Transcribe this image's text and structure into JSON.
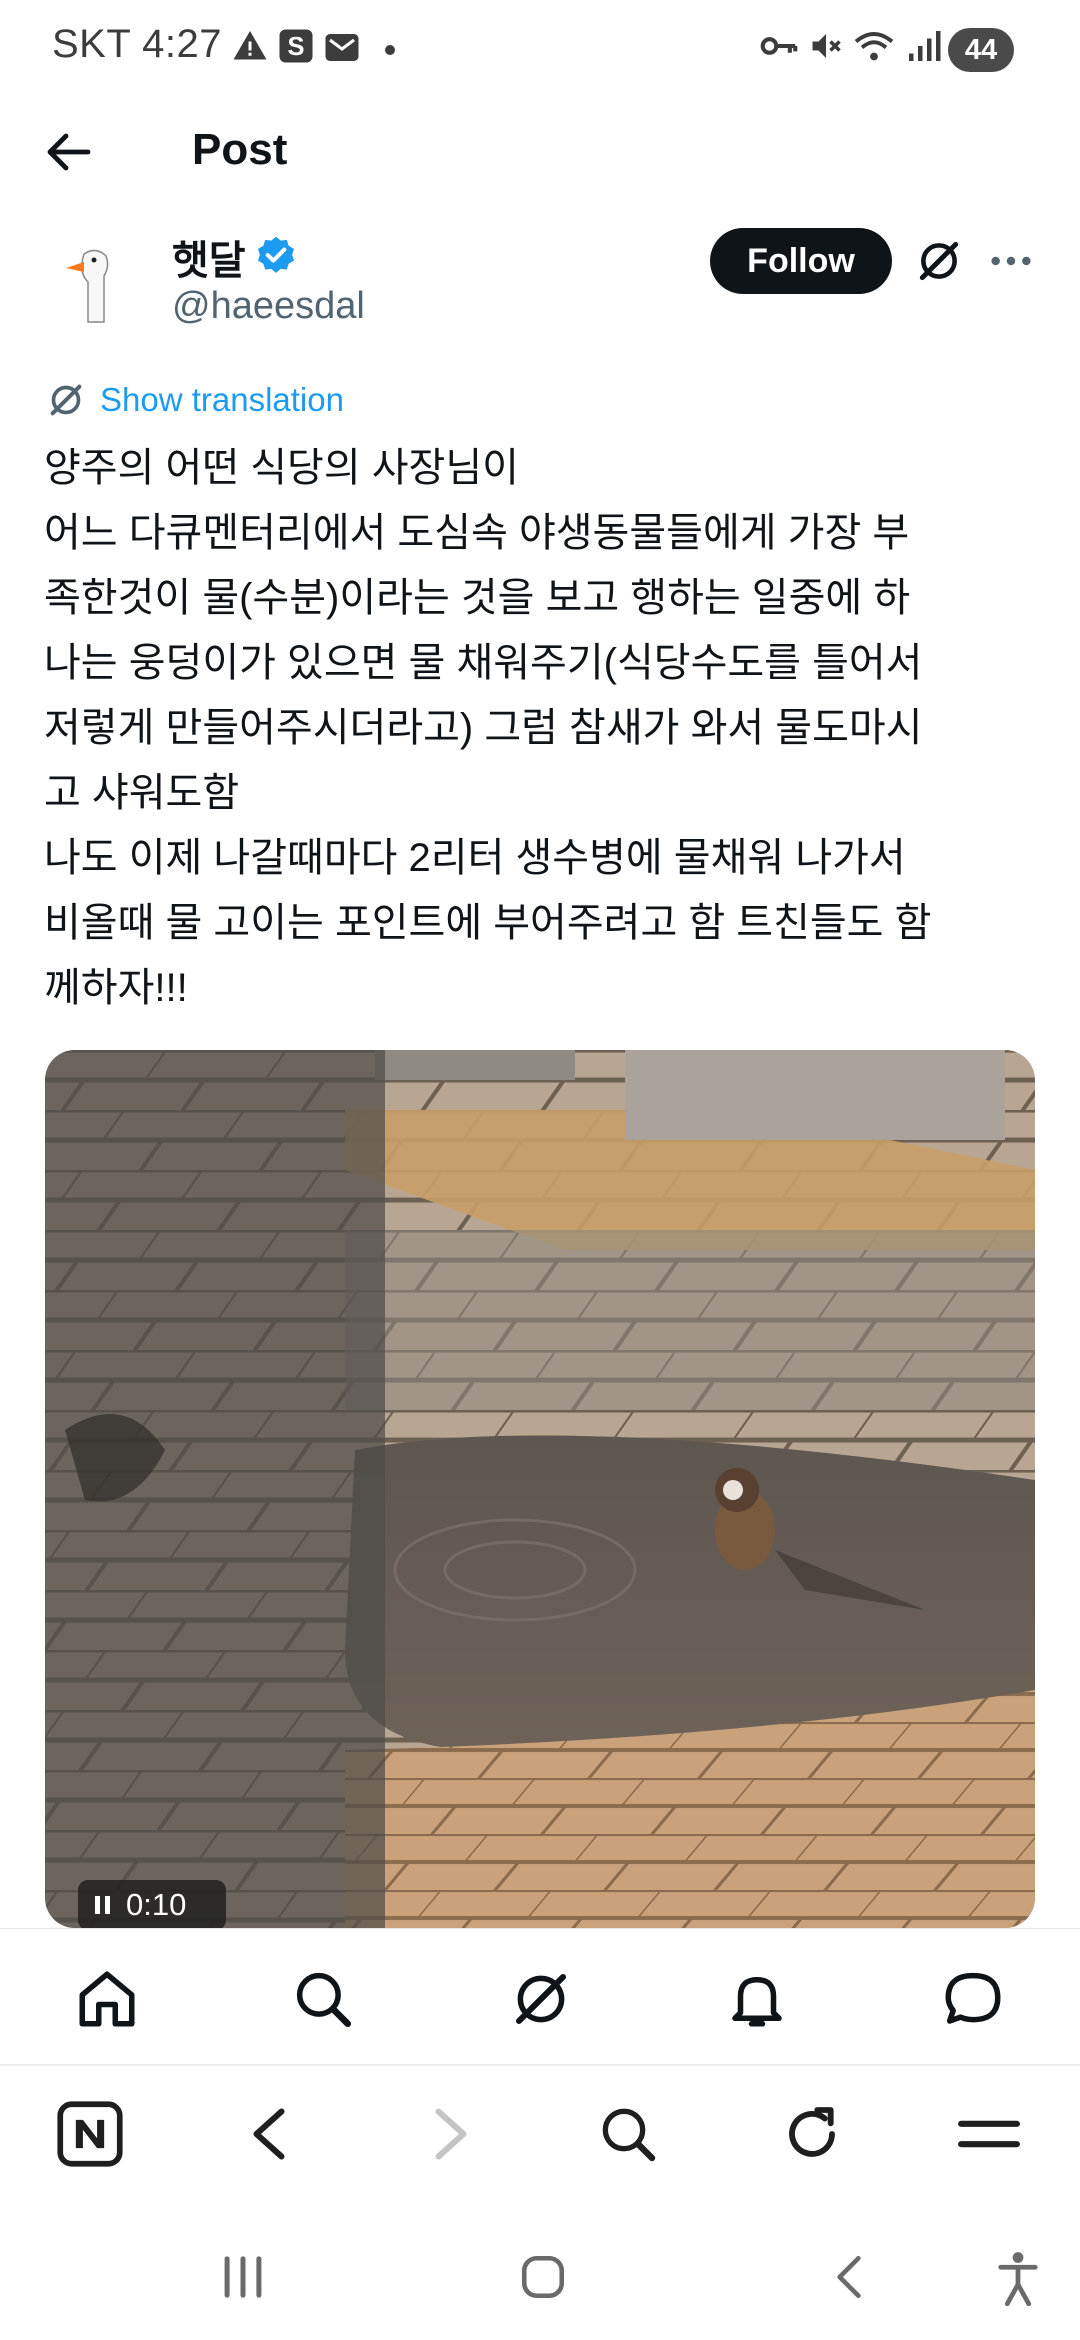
{
  "status_bar": {
    "carrier_time": "SKT 4:27",
    "battery": "44"
  },
  "header": {
    "title": "Post",
    "icons": [
      "back-arrow-icon"
    ]
  },
  "author": {
    "display_name": "햇달",
    "handle": "@haeesdal",
    "verified": true,
    "follow_label": "Follow"
  },
  "translation": {
    "label": "Show translation"
  },
  "post": {
    "lines": [
      "양주의 어떤 식당의 사장님이",
      "어느 다큐멘터리에서 도심속 야생동물들에게 가장 부",
      "족한것이 물(수분)이라는 것을 보고 행하는 일중에 하",
      "나는 웅덩이가 있으면 물 채워주기(식당수도를 틀어서",
      "저렇게 만들어주시더라고) 그럼 참새가 와서 물도마시",
      "고 샤워도함",
      "나도 이제 나갈때마다 2리터 생수병에 물채워 나가서",
      "비올때 물 고이는 포인트에 부어주려고 함 트친들도 함",
      "께하자!!!"
    ]
  },
  "video": {
    "time": "0:10"
  },
  "bottom_nav": {
    "icons": [
      "home-icon",
      "search-icon",
      "grok-icon",
      "notifications-bell-icon",
      "messages-icon"
    ]
  },
  "browser_bar": {
    "icons": [
      "naver-n-icon",
      "browser-back-icon",
      "browser-forward-icon",
      "browser-search-icon",
      "refresh-icon",
      "menu-icon"
    ]
  },
  "system_nav": {
    "icons": [
      "recents-icon",
      "home-button-icon",
      "system-back-icon",
      "accessibility-icon"
    ]
  },
  "colors": {
    "link_blue": "#1d9bf0",
    "text_primary": "#0f1419",
    "text_secondary": "#536471",
    "follow_bg": "#0f1419"
  }
}
